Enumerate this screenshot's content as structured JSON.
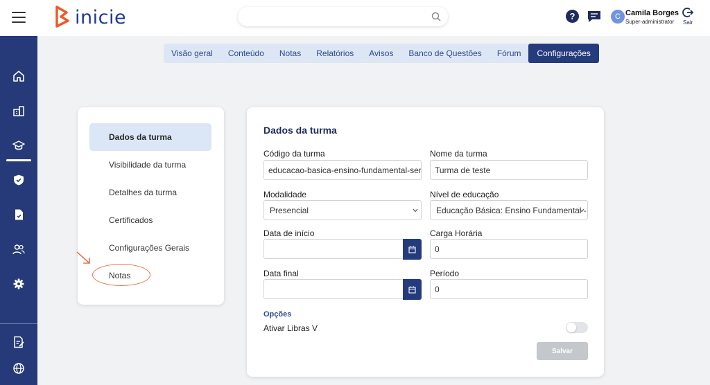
{
  "header": {
    "logo_text": "inicie",
    "search_placeholder": "",
    "help_symbol": "?",
    "user": {
      "initial": "C",
      "name": "Camila Borges",
      "role": "Super-administrator"
    },
    "logout_label": "Sair"
  },
  "sidebar": {
    "items": [
      {
        "icon": "home-icon"
      },
      {
        "icon": "building-icon"
      },
      {
        "icon": "graduation-cap-icon",
        "active": true
      },
      {
        "icon": "shield-icon"
      },
      {
        "icon": "file-icon"
      },
      {
        "icon": "users-icon"
      },
      {
        "icon": "gear-icon"
      },
      {
        "icon": "report-icon"
      },
      {
        "icon": "globe-icon"
      }
    ]
  },
  "tabs": [
    {
      "label": "Visão geral"
    },
    {
      "label": "Conteúdo"
    },
    {
      "label": "Notas"
    },
    {
      "label": "Relatórios"
    },
    {
      "label": "Avisos"
    },
    {
      "label": "Banco de Questões"
    },
    {
      "label": "Fórum"
    },
    {
      "label": "Configurações",
      "active": true
    }
  ],
  "menu": {
    "items": [
      {
        "label": "Dados da turma",
        "active": true
      },
      {
        "label": "Visibilidade da turma"
      },
      {
        "label": "Detalhes da turma"
      },
      {
        "label": "Certificados"
      },
      {
        "label": "Configurações Gerais"
      },
      {
        "label": "Notas"
      }
    ]
  },
  "form": {
    "title": "Dados da turma",
    "codigo": {
      "label": "Código da turma",
      "value": "educacao-basica-ensino-fundamental-serie"
    },
    "nome": {
      "label": "Nome da turma",
      "value": "Turma de teste"
    },
    "modalidade": {
      "label": "Modalidade",
      "value": "Presencial"
    },
    "nivel": {
      "label": "Nível de educação",
      "value": "Educação Básica: Ensino Fundamental -"
    },
    "data_inicio": {
      "label": "Data de início",
      "value": ""
    },
    "carga": {
      "label": "Carga Horária",
      "value": "0"
    },
    "data_final": {
      "label": "Data final",
      "value": ""
    },
    "periodo": {
      "label": "Período",
      "value": "0"
    },
    "opcoes_label": "Opções",
    "libras_label": "Ativar Libras V",
    "libras_enabled": false,
    "save_label": "Salvar"
  },
  "colors": {
    "primary": "#243b7d",
    "sidebar": "#263a7a",
    "accent": "#e8734a"
  }
}
